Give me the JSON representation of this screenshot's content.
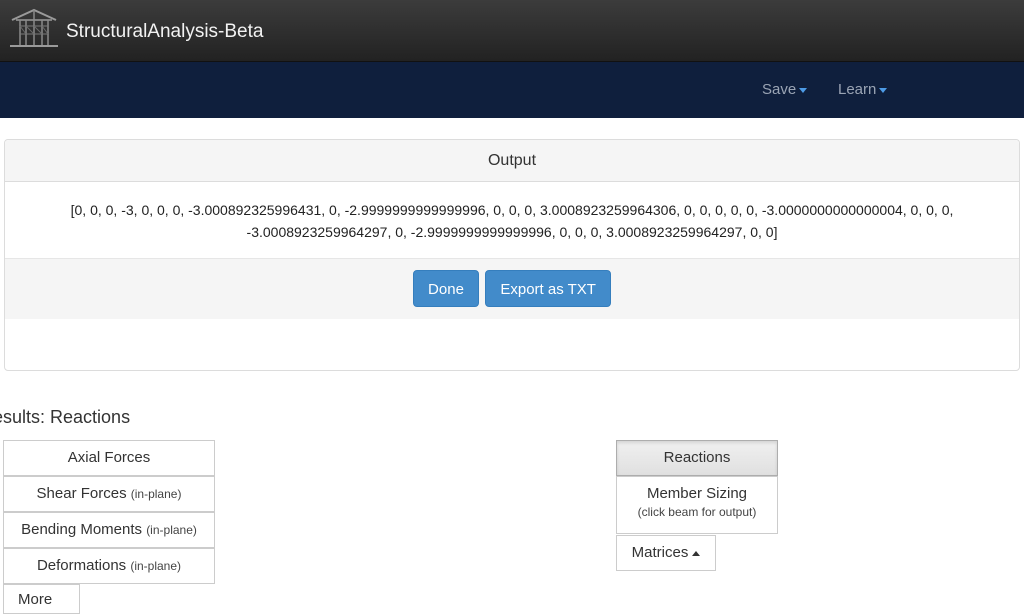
{
  "app": {
    "title": "StructuralAnalysis-Beta"
  },
  "nav": {
    "save_label": "Save",
    "learn_label": "Learn"
  },
  "output_panel": {
    "heading": "Output",
    "text": "[0, 0, 0, -3, 0, 0, 0, -3.000892325996431, 0, -2.9999999999999996, 0, 0, 0, 3.0008923259964306, 0, 0, 0, 0, 0, -3.0000000000000004, 0, 0, 0, -3.0008923259964297, 0, -2.9999999999999996, 0, 0, 0, 3.0008923259964297, 0, 0]",
    "done_label": "Done",
    "export_label": "Export as TXT"
  },
  "results": {
    "title": "esults: Reactions",
    "left_buttons": [
      {
        "label": "Axial Forces",
        "note": ""
      },
      {
        "label": "Shear Forces",
        "note": "(in-plane)"
      },
      {
        "label": "Bending Moments",
        "note": "(in-plane)"
      },
      {
        "label": "Deformations",
        "note": "(in-plane)"
      }
    ],
    "more_label": "More",
    "reactions_label": "Reactions",
    "member_sizing_label": "Member Sizing",
    "member_sizing_note": "(click beam for output)",
    "matrices_label": "Matrices"
  },
  "colors": {
    "topbar": "#2b2b2b",
    "navbar": "#0f1f3d",
    "primary_button": "#428bca",
    "caret_accent": "#4d9be6"
  }
}
